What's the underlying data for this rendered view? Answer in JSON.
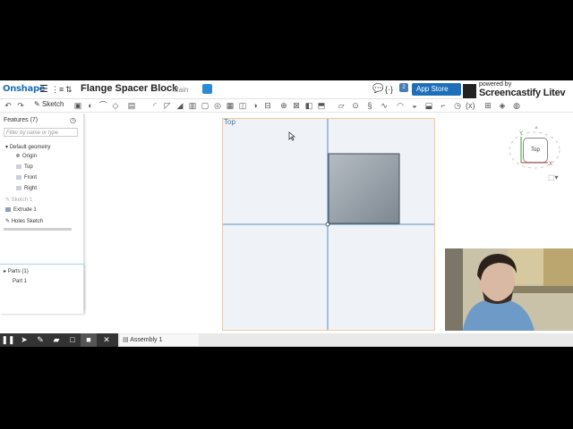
{
  "header": {
    "logo": "Onshape",
    "document_title": "Flange Spacer Block",
    "branch": "Main",
    "app_store_label": "App Store",
    "notification_count": "2"
  },
  "toolbar": {
    "sketch_label": "Sketch"
  },
  "feature_panel": {
    "title": "Features (7)",
    "filter_placeholder": "Filter by name or type",
    "items": [
      {
        "label": "Default geometry"
      },
      {
        "label": "Origin"
      },
      {
        "label": "Top"
      },
      {
        "label": "Front"
      },
      {
        "label": "Right"
      },
      {
        "label": "Sketch 1"
      },
      {
        "label": "Extrude 1"
      },
      {
        "label": "Holes Sketch"
      }
    ]
  },
  "parts_panel": {
    "title": "Parts (1)",
    "items": [
      {
        "label": "Part 1"
      }
    ]
  },
  "viewport": {
    "view_label": "Top",
    "view_cube_label": "Top"
  },
  "tabs": [
    {
      "label": "Assembly 1"
    }
  ],
  "overlay": {
    "powered_by": "powered by",
    "brand": "Screencastify Litev"
  },
  "colors": {
    "accent": "#1d70b8",
    "viewport_bg": "#eff3f7",
    "viewport_border": "#f3c998",
    "sketch_axis": "#5a8fc2"
  }
}
